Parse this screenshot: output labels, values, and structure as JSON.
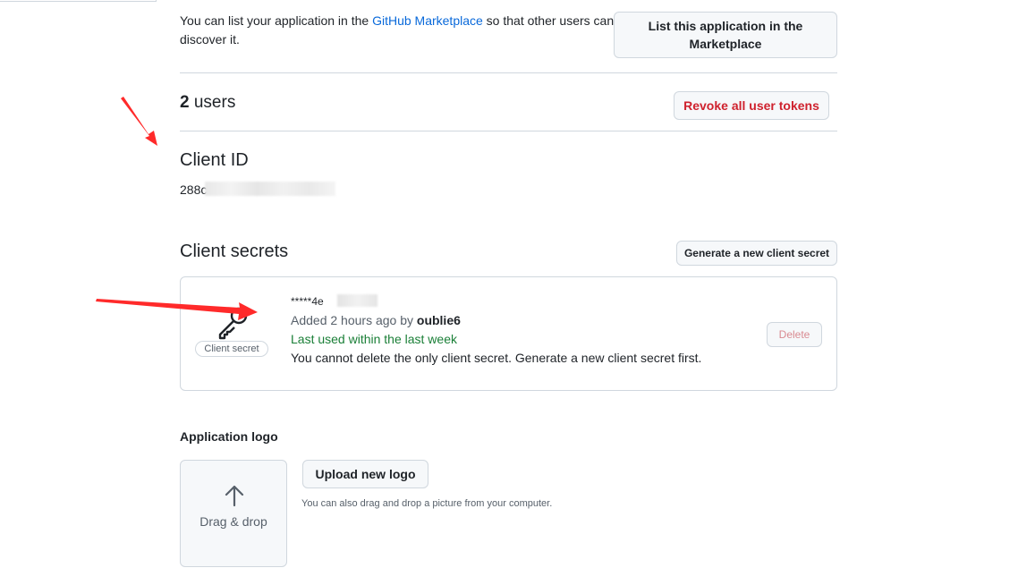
{
  "marketplace": {
    "text_before": "You can list your application in the ",
    "link": "GitHub Marketplace",
    "text_after": " so that other users can discover it.",
    "button": "List this application in the Marketplace"
  },
  "users": {
    "count": "2",
    "label": " users",
    "revoke_button": "Revoke all user tokens"
  },
  "client_id": {
    "heading": "Client ID",
    "value_visible": "288c"
  },
  "client_secrets": {
    "heading": "Client secrets",
    "generate_button": "Generate a new client secret",
    "secret": {
      "badge": "Client secret",
      "masked_visible": "*****4e",
      "added_prefix": "Added 2 hours ago by ",
      "added_user": "oublie6",
      "last_used": "Last used within the last week",
      "note": "You cannot delete the only client secret. Generate a new client secret first.",
      "delete_button": "Delete",
      "icon": "key-icon"
    }
  },
  "application_logo": {
    "heading": "Application logo",
    "drop_label": "Drag & drop",
    "upload_button": "Upload new logo",
    "hint": "You can also drag and drop a picture from your computer.",
    "icon": "upload-icon"
  },
  "colors": {
    "link": "#0969da",
    "danger": "#cf222e",
    "success": "#1a7f37",
    "annotation_arrow": "#ff2a2a"
  }
}
